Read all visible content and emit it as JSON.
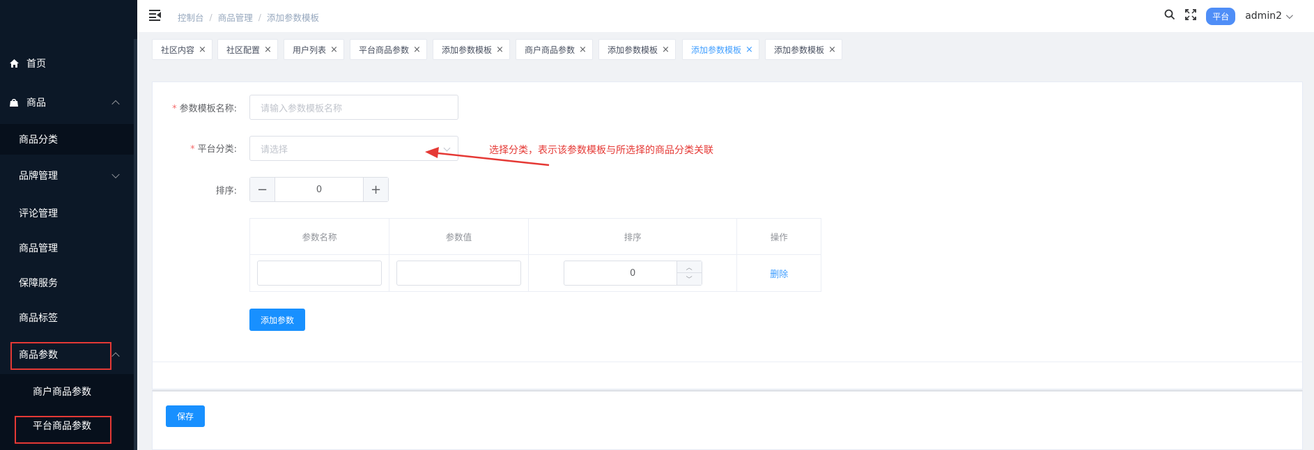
{
  "sidebar": {
    "home": "首页",
    "goods": "商品",
    "items": {
      "category": "商品分类",
      "brand": "品牌管理",
      "review": "评论管理",
      "goods_manage": "商品管理",
      "guarantee": "保障服务",
      "tag": "商品标签",
      "params": "商品参数",
      "merchant_params": "商户商品参数",
      "platform_params": "平台商品参数"
    }
  },
  "header": {
    "breadcrumb": [
      "控制台",
      "商品管理",
      "添加参数模板"
    ],
    "platform_badge": "平台",
    "username": "admin2"
  },
  "tags": [
    {
      "label": "社区内容",
      "active": false
    },
    {
      "label": "社区配置",
      "active": false
    },
    {
      "label": "用户列表",
      "active": false
    },
    {
      "label": "平台商品参数",
      "active": false
    },
    {
      "label": "添加参数模板",
      "active": false
    },
    {
      "label": "商户商品参数",
      "active": false
    },
    {
      "label": "添加参数模板",
      "active": false
    },
    {
      "label": "添加参数模板",
      "active": true
    },
    {
      "label": "添加参数模板",
      "active": false
    }
  ],
  "form": {
    "name_label": "参数模板名称:",
    "name_placeholder": "请输入参数模板名称",
    "category_label": "平台分类:",
    "category_placeholder": "请选择",
    "sort_label": "排序:",
    "sort_value": "0",
    "annotation": "选择分类，表示该参数模板与所选择的商品分类关联"
  },
  "table": {
    "headers": [
      "参数名称",
      "参数值",
      "排序",
      "操作"
    ],
    "rows": [
      {
        "name": "",
        "value": "",
        "sort": "0",
        "action": "删除"
      }
    ]
  },
  "buttons": {
    "add_param": "添加参数",
    "save": "保存"
  },
  "colors": {
    "sidebar_bg": "#0c1827",
    "primary": "#1890ff",
    "annotation": "#e53935",
    "badge": "#4f8ef7"
  }
}
